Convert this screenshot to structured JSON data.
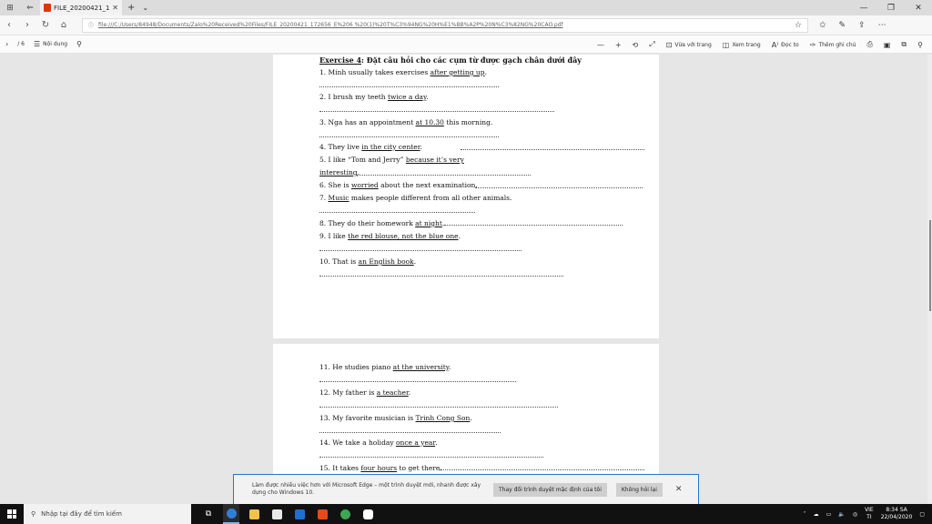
{
  "browser": {
    "tab_title": "FILE_20200421_172656_",
    "url": "file:///C:/Users/84948/Documents/Zalo%20Received%20Files/FILE_20200421_172656_E%206 %20(1)%20T%C3%94NG%20H%E1%BB%A2P%20N%C3%82NG%20CAO.pdf",
    "new_tab": "+",
    "toolbar": {
      "toc_label": "Nội dung",
      "read_aloud": "Vừa với trang",
      "page_view": "Xem trang",
      "read": "Đọc to",
      "add_notes": "Thêm ghi chú"
    }
  },
  "document": {
    "heading": "Exercise 4",
    "heading_rest": ": Đặt câu hỏi cho các cụm từ được gạch chân dưới đây",
    "items": [
      {
        "pre": "1. Minh usually takes exercises ",
        "u": "after getting up",
        "post": "."
      },
      {
        "pre": "2. I brush my teeth ",
        "u": "twice a day",
        "post": "."
      },
      {
        "pre": "3. Nga has an appointment ",
        "u": "at 10.30",
        "post": " this morning."
      },
      {
        "pre": "4. They live ",
        "u": "in the city center",
        "post": "."
      },
      {
        "pre": "5. I like “Tom and Jerry” ",
        "u": "because it’s very",
        "post": ""
      },
      {
        "pre": "",
        "u": "interesting",
        "post": "."
      },
      {
        "pre": "6. She is ",
        "u": "worried",
        "post": " about the next examination."
      },
      {
        "pre": "7. ",
        "u": "Music",
        "post": " makes people different from all other animals."
      },
      {
        "pre": "8. They do their homework ",
        "u": "at night",
        "post": "."
      },
      {
        "pre": "9. I like ",
        "u": "the red blouse, not the blue one",
        "post": "."
      },
      {
        "pre": "10. That is ",
        "u": "an English book",
        "post": "."
      },
      {
        "pre": "11. He studies piano ",
        "u": "at the university",
        "post": "."
      },
      {
        "pre": "12. My father is ",
        "u": "a teacher",
        "post": "."
      },
      {
        "pre": "13. My favorite musician is ",
        "u": "Trinh Cong Son",
        "post": "."
      },
      {
        "pre": "14. We take a holiday ",
        "u": "once a year",
        "post": "."
      },
      {
        "pre": "15. It takes ",
        "u": "four hours",
        "post": " to get there."
      }
    ]
  },
  "notification": {
    "message": "Làm được nhiều việc hơn với Microsoft Edge – một trình duyệt mới, nhanh được xây dựng cho Windows 10.",
    "primary_button": "Thay đổi trình duyệt mặc định của tôi",
    "secondary_button": "Không hỏi lại",
    "close": "✕"
  },
  "taskbar": {
    "search_placeholder": "Nhập tại đây để tìm kiếm",
    "lang_top": "VIE",
    "lang_bottom": "TI",
    "time": "8:34 SA",
    "date": "22/04/2020"
  }
}
